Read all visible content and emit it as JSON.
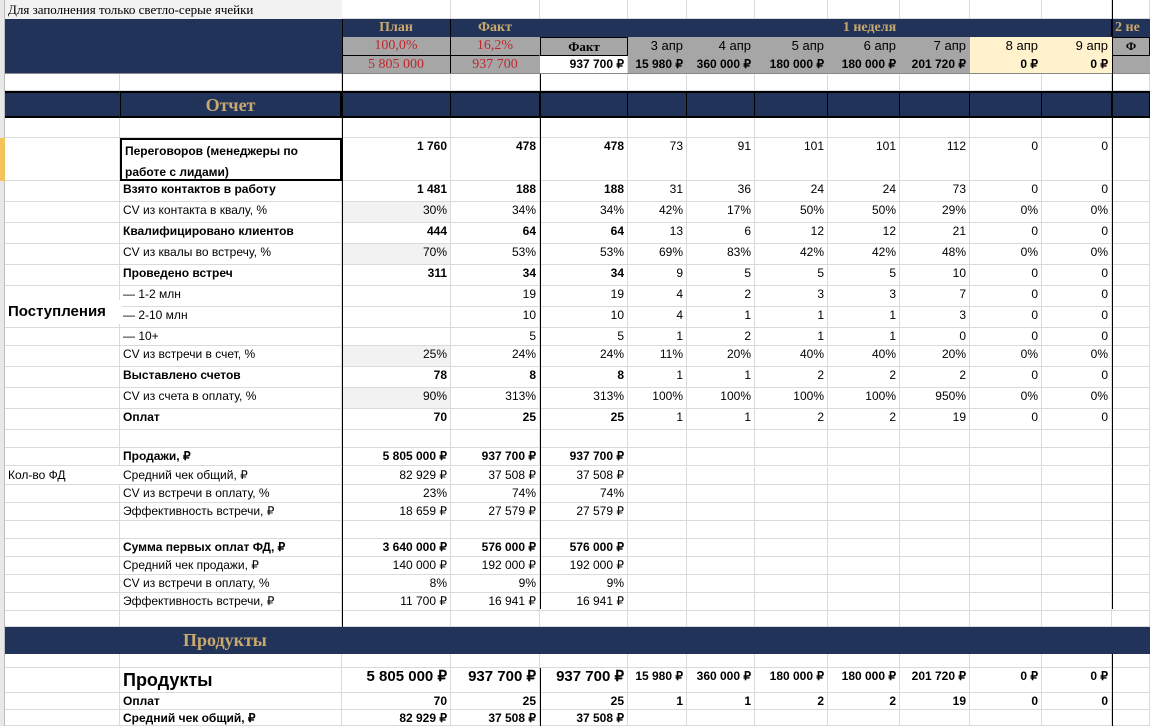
{
  "note": "Для заполнения только светло-серые ячейки",
  "header": {
    "plan_label": "План",
    "fact_label": "Факт",
    "plan_percent": "100,0%",
    "fact_percent": "16,2%",
    "plan_total": "5 805 000",
    "fact_total": "937 700",
    "fact_col_label": "Факт",
    "fact_col_value": "937 700 ₽",
    "week1_label": "1 неделя",
    "week2_label": "2 не",
    "week2_fact_label": "Ф",
    "days": [
      "3 апр",
      "4 апр",
      "5 апр",
      "6 апр",
      "7 апр",
      "8 апр",
      "9 апр"
    ],
    "day_totals": [
      "15 980 ₽",
      "360 000 ₽",
      "180 000 ₽",
      "180 000 ₽",
      "201 720 ₽",
      "0 ₽",
      "0 ₽"
    ]
  },
  "colors": {
    "navy": "#22335a",
    "gold": "#c9a96e",
    "red": "#c0272d",
    "gray": "#a6a6a6",
    "weekend": "#fff2cc"
  },
  "report": {
    "title": "Отчет",
    "group_label": "Поступления",
    "fd_label": "Кол-во ФД",
    "rows": [
      {
        "label": "Переговоров (менеджеры по работе с лидами)",
        "plan": "1 760",
        "fact": "478",
        "fact_total": "478",
        "days": [
          "73",
          "91",
          "101",
          "101",
          "112",
          "0",
          "0"
        ]
      },
      {
        "label": "Взято контактов в работу",
        "plan": "1 481",
        "fact": "188",
        "fact_total": "188",
        "days": [
          "31",
          "36",
          "24",
          "24",
          "73",
          "0",
          "0"
        ]
      },
      {
        "label": "CV из контакта в квалу, %",
        "plan": "30%",
        "fact": "34%",
        "fact_total": "34%",
        "days": [
          "42%",
          "17%",
          "50%",
          "50%",
          "29%",
          "0%",
          "0%"
        ]
      },
      {
        "label": "Квалифицировано клиентов",
        "plan": "444",
        "fact": "64",
        "fact_total": "64",
        "days": [
          "13",
          "6",
          "12",
          "12",
          "21",
          "0",
          "0"
        ]
      },
      {
        "label": "CV из квалы во встречу, %",
        "plan": "70%",
        "fact": "53%",
        "fact_total": "53%",
        "days": [
          "69%",
          "83%",
          "42%",
          "42%",
          "48%",
          "0%",
          "0%"
        ]
      },
      {
        "label": "Проведено встреч",
        "plan": "311",
        "fact": "34",
        "fact_total": "34",
        "days": [
          "9",
          "5",
          "5",
          "5",
          "10",
          "0",
          "0"
        ]
      },
      {
        "label": "— 1-2 млн",
        "plan": "",
        "fact": "19",
        "fact_total": "19",
        "days": [
          "4",
          "2",
          "3",
          "3",
          "7",
          "0",
          "0"
        ]
      },
      {
        "label": "— 2-10 млн",
        "plan": "",
        "fact": "10",
        "fact_total": "10",
        "days": [
          "4",
          "1",
          "1",
          "1",
          "3",
          "0",
          "0"
        ]
      },
      {
        "label": "— 10+",
        "plan": "",
        "fact": "5",
        "fact_total": "5",
        "days": [
          "1",
          "2",
          "1",
          "1",
          "0",
          "0",
          "0"
        ]
      },
      {
        "label": "CV из встречи в счет, %",
        "plan": "25%",
        "fact": "24%",
        "fact_total": "24%",
        "days": [
          "11%",
          "20%",
          "40%",
          "40%",
          "20%",
          "0%",
          "0%"
        ]
      },
      {
        "label": "Выставлено счетов",
        "plan": "78",
        "fact": "8",
        "fact_total": "8",
        "days": [
          "1",
          "1",
          "2",
          "2",
          "2",
          "0",
          "0"
        ]
      },
      {
        "label": "CV из счета в оплату, %",
        "plan": "90%",
        "fact": "313%",
        "fact_total": "313%",
        "days": [
          "100%",
          "100%",
          "100%",
          "100%",
          "950%",
          "0%",
          "0%"
        ]
      },
      {
        "label": "Оплат",
        "plan": "70",
        "fact": "25",
        "fact_total": "25",
        "days": [
          "1",
          "1",
          "2",
          "2",
          "19",
          "0",
          "0"
        ]
      }
    ],
    "sales_rows": [
      {
        "label": "Продажи, ₽",
        "plan": "5 805 000 ₽",
        "fact": "937 700 ₽",
        "fact_total": "937 700 ₽"
      },
      {
        "label": "Средний чек общий, ₽",
        "plan": "82 929 ₽",
        "fact": "37 508 ₽",
        "fact_total": "37 508 ₽"
      },
      {
        "label": "CV из встречи в оплату, %",
        "plan": "23%",
        "fact": "74%",
        "fact_total": "74%"
      },
      {
        "label": "Эффективность встречи, ₽",
        "plan": "18 659 ₽",
        "fact": "27 579 ₽",
        "fact_total": "27 579 ₽"
      }
    ],
    "fd_rows": [
      {
        "label": "Сумма первых оплат ФД, ₽",
        "plan": "3 640 000 ₽",
        "fact": "576 000 ₽",
        "fact_total": "576 000 ₽"
      },
      {
        "label": "Средний чек продажи, ₽",
        "plan": "140 000 ₽",
        "fact": "192 000 ₽",
        "fact_total": "192 000 ₽"
      },
      {
        "label": "CV из встречи в оплату, %",
        "plan": "8%",
        "fact": "9%",
        "fact_total": "9%"
      },
      {
        "label": "Эффективность встречи, ₽",
        "plan": "11 700 ₽",
        "fact": "16 941 ₽",
        "fact_total": "16 941 ₽"
      }
    ]
  },
  "products": {
    "title": "Продукты",
    "rows": [
      {
        "label": "Продукты",
        "plan": "5 805 000 ₽",
        "fact": "937 700 ₽",
        "fact_total": "937 700 ₽",
        "days": [
          "15 980 ₽",
          "360 000 ₽",
          "180 000 ₽",
          "180 000 ₽",
          "201 720 ₽",
          "0 ₽",
          "0 ₽"
        ]
      },
      {
        "label": "Оплат",
        "plan": "70",
        "fact": "25",
        "fact_total": "25",
        "days": [
          "1",
          "1",
          "2",
          "2",
          "19",
          "0",
          "0"
        ]
      },
      {
        "label": "Средний чек общий, ₽",
        "plan": "82 929 ₽",
        "fact": "37 508 ₽",
        "fact_total": "37 508 ₽"
      }
    ]
  }
}
